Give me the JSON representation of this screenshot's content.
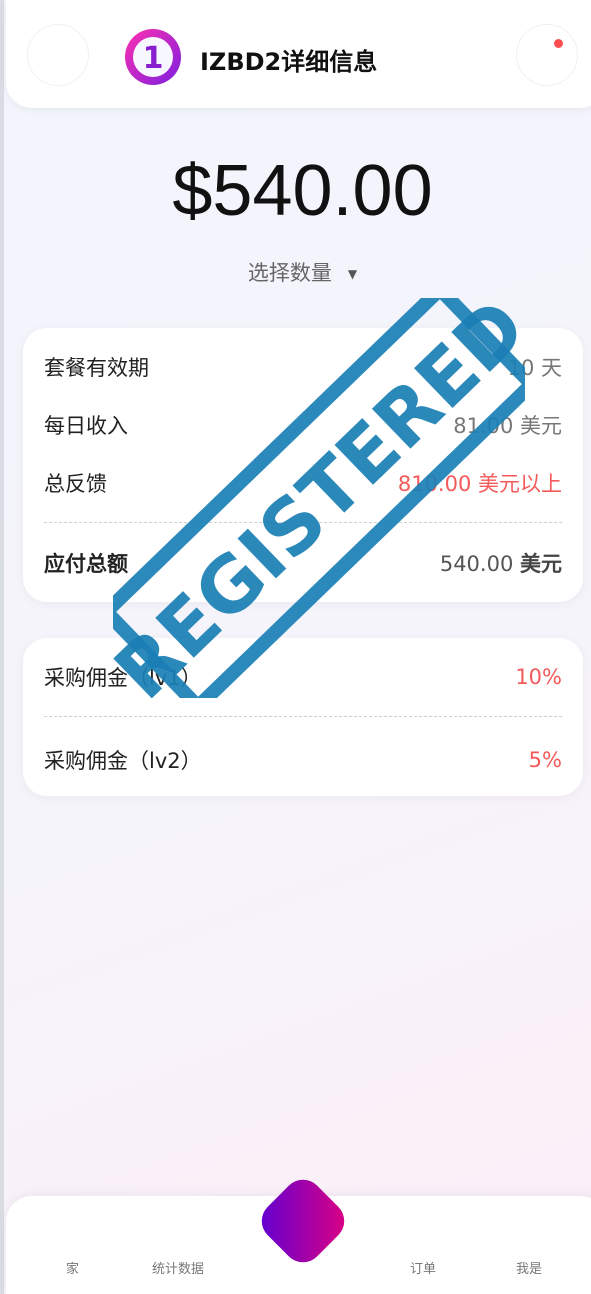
{
  "header": {
    "title": "IZBD2详细信息",
    "logo_text": "1"
  },
  "price": "$540.00",
  "quantity_selector": {
    "label": "选择数量",
    "caret": "▼"
  },
  "details": {
    "rows": [
      {
        "label": "套餐有效期",
        "value": "10 天"
      },
      {
        "label": "每日收入",
        "value": "81.00 美元"
      },
      {
        "label": "总反馈",
        "value": "810.00 美元以上"
      }
    ],
    "total": {
      "label": "应付总额",
      "amount": "540.00",
      "currency": "美元"
    }
  },
  "commissions": [
    {
      "label": "采购佣金（lv1）",
      "value": "10%"
    },
    {
      "label": "采购佣金（lv2）",
      "value": "5%"
    }
  ],
  "stamp_text": "REGISTERED",
  "bottom_nav": {
    "items": [
      {
        "label": "家"
      },
      {
        "label": "统计数据"
      },
      {
        "label": "订单"
      },
      {
        "label": "我是"
      }
    ]
  },
  "colors": {
    "accent_red": "#f55a5a",
    "stamp_blue": "#1a7fb5",
    "gradient_start": "#e3007e",
    "gradient_end": "#5a00d6"
  }
}
